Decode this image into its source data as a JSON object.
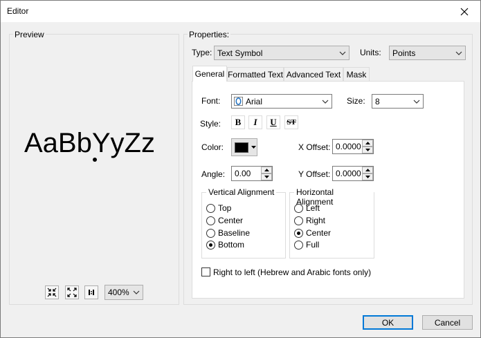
{
  "window": {
    "title": "Editor"
  },
  "preview": {
    "group_label": "Preview",
    "sample_text": "AaBbYyZz",
    "zoom": {
      "value": "400%"
    }
  },
  "properties": {
    "group_label": "Properties:",
    "type": {
      "label": "Type:",
      "value": "Text Symbol"
    },
    "units": {
      "label": "Units:",
      "value": "Points"
    },
    "tabs": [
      {
        "label": "General",
        "active": true
      },
      {
        "label": "Formatted Text",
        "active": false
      },
      {
        "label": "Advanced Text",
        "active": false
      },
      {
        "label": "Mask",
        "active": false
      }
    ]
  },
  "general": {
    "font": {
      "label": "Font:",
      "value": "Arial"
    },
    "size": {
      "label": "Size:",
      "value": "8"
    },
    "style": {
      "label": "Style:",
      "bold": "B",
      "italic": "I",
      "underline": "U",
      "strike": "ST"
    },
    "color": {
      "label": "Color:",
      "value": "#000000"
    },
    "x_offset": {
      "label": "X Offset:",
      "value": "0.0000"
    },
    "angle": {
      "label": "Angle:",
      "value": "0.00"
    },
    "y_offset": {
      "label": "Y Offset:",
      "value": "0.0000"
    },
    "vertical_alignment": {
      "label": "Vertical Alignment",
      "options": [
        "Top",
        "Center",
        "Baseline",
        "Bottom"
      ],
      "selected": "Bottom"
    },
    "horizontal_alignment": {
      "label": "Horizontal Alignment",
      "options": [
        "Left",
        "Right",
        "Center",
        "Full"
      ],
      "selected": "Center"
    },
    "rtl": {
      "label": "Right to left (Hebrew and Arabic fonts only)",
      "checked": false
    }
  },
  "buttons": {
    "ok": "OK",
    "cancel": "Cancel"
  },
  "colors": {
    "accent": "#0078d7",
    "swatch": "#000000"
  }
}
